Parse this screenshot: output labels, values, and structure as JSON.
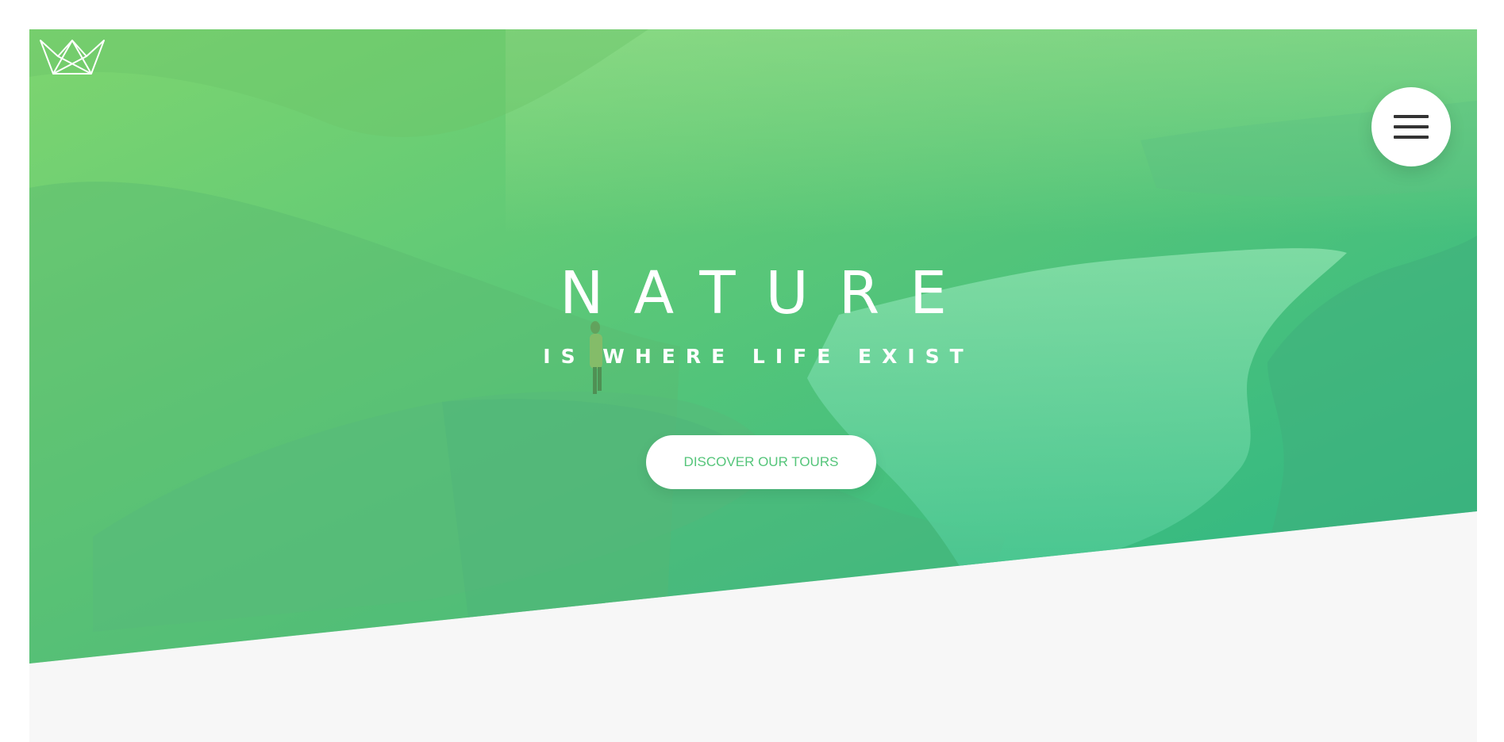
{
  "colors": {
    "accent": "#55c57a",
    "accent_light": "#7ed56f",
    "accent_dark": "#28b485",
    "page_bg": "#f7f7f7",
    "menu_icon": "#333333"
  },
  "header": {
    "logo_icon": "crown-outline-logo",
    "menu_icon": "hamburger-menu-icon"
  },
  "hero": {
    "title_main": "NATURE",
    "title_sub": "IS WHERE LIFE EXIST",
    "cta_label": "DISCOVER OUR TOURS"
  }
}
